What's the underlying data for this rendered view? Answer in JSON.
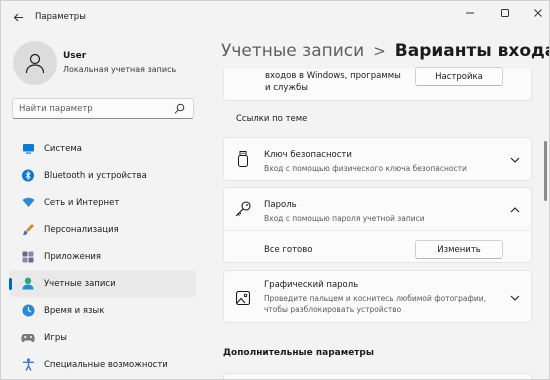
{
  "window": {
    "title": "Параметры",
    "controls": [
      "minimize",
      "maximize",
      "close"
    ]
  },
  "user": {
    "name": "User",
    "account_type": "Локальная учетная запись"
  },
  "search": {
    "placeholder": "Найти параметр"
  },
  "sidebar": {
    "items": [
      {
        "label": "Система",
        "icon": "system-icon",
        "color": "#0a7ad8"
      },
      {
        "label": "Bluetooth и устройства",
        "icon": "bluetooth-icon",
        "color": "#0a7ad8"
      },
      {
        "label": "Сеть и Интернет",
        "icon": "network-icon",
        "color": "#2d8ad6"
      },
      {
        "label": "Персонализация",
        "icon": "personalization-icon",
        "color": "#d08a3a"
      },
      {
        "label": "Приложения",
        "icon": "apps-icon",
        "color": "#6b6b8a"
      },
      {
        "label": "Учетные записи",
        "icon": "accounts-icon",
        "color": "#2aa876",
        "active": true
      },
      {
        "label": "Время и язык",
        "icon": "time-language-icon",
        "color": "#2a8ad8"
      },
      {
        "label": "Игры",
        "icon": "gaming-icon",
        "color": "#777777"
      },
      {
        "label": "Специальные возможности",
        "icon": "accessibility-icon",
        "color": "#3a7bd5"
      }
    ]
  },
  "breadcrumb": {
    "parent": "Учетные записи",
    "separator": ">",
    "current": "Варианты входа"
  },
  "main": {
    "top_card": {
      "text_line1": "входов в Windows, программы",
      "text_line2": "и службы",
      "button": "Настройка"
    },
    "related_header": "Ссылки по теме",
    "security_key": {
      "title": "Ключ безопасности",
      "subtitle": "Вход с помощью физического ключа безопасности",
      "icon": "usb-key-icon"
    },
    "password": {
      "title": "Пароль",
      "subtitle": "Вход с помощью пароля учетной записи",
      "status": "Все готово",
      "button": "Изменить",
      "icon": "key-icon"
    },
    "picture_password": {
      "title": "Графический пароль",
      "subtitle_line1": "Проведите пальцем и коснитесь любимой фотографии,",
      "subtitle_line2": "чтобы разблокировать устройство",
      "icon": "picture-icon"
    },
    "additional_header": "Дополнительные параметры"
  },
  "colors": {
    "accent": "#0067c0",
    "background": "#f3f3f3",
    "card": "#fbfbfb"
  }
}
